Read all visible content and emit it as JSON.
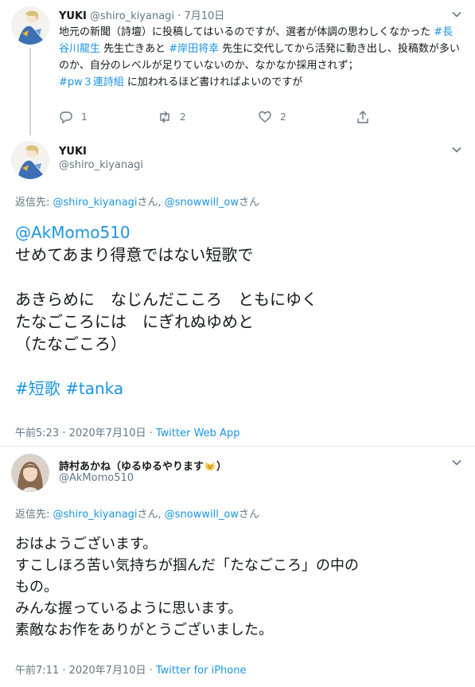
{
  "tweet1": {
    "name": "YUKI",
    "handle": "@shiro_kiyanagi",
    "separator": "·",
    "date": "7月10日",
    "text_a": "地元の新聞（詩壇）に投稿してはいるのですが、選者が体調の思わしくなかった ",
    "tag1": "#長谷川龍生",
    "text_b": " 先生亡きあと ",
    "tag2": "#岸田将幸",
    "text_c": " 先生に交代してから活発に動き出し、投稿数が多いのか、自分のレベルが足りていないのか、なかなか採用されず；",
    "tag3": "#pw３連詩組",
    "text_d": " に加われるほど書ければよいのですが",
    "actions": {
      "reply_count": "1",
      "retweet_count": "2",
      "like_count": "2"
    }
  },
  "tweet2": {
    "name": "YUKI",
    "handle": "@shiro_kiyanagi",
    "reply_prefix": "返信先: ",
    "reply_user1": "@shiro_kiyanagi",
    "reply_mid": "さん, ",
    "reply_user2": "@snowwill_ow",
    "reply_suffix": "さん",
    "mention": "@AkMomo510",
    "line1": "せめてあまり得意ではない短歌で",
    "line2": "あきらめに　なじんだこころ　ともにゆく",
    "line3": "たなごころには　にぎれぬゆめと",
    "line4": "（たなごころ）",
    "hashtag1": "#短歌",
    "hashtag2": "#tanka",
    "time": "午前5:23 · 2020年7月10日 · ",
    "source": "Twitter Web App"
  },
  "tweet3": {
    "name": "詩村あかね（ゆるゆるやります",
    "name_end": "）",
    "emoji": "smiling-cat-emoji",
    "handle": "@AkMomo510",
    "reply_prefix": "返信先: ",
    "reply_user1": "@shiro_kiyanagi",
    "reply_mid": "さん, ",
    "reply_user2": "@snowwill_ow",
    "reply_suffix": "さん",
    "line1": "おはようございます。",
    "line2": "すこしほろ苦い気持ちが掴んだ「たなごころ」の中の",
    "line3": "もの。",
    "line4": "みんな握っているように思います。",
    "line5": "素敵なお作をありがとうございました。",
    "time": "午前7:11 · 2020年7月10日 · ",
    "source": "Twitter for iPhone"
  },
  "colors": {
    "link": "#1b95e0",
    "muted": "#657786",
    "text": "#14171a",
    "divider": "#e6ecf0"
  }
}
